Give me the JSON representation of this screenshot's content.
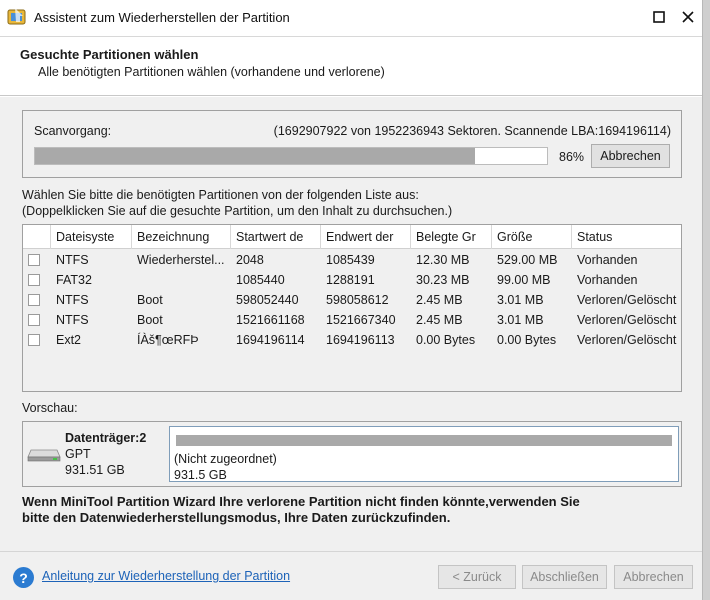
{
  "window": {
    "title": "Assistent zum Wiederherstellen der Partition"
  },
  "header": {
    "title": "Gesuchte Partitionen wählen",
    "subtitle": "Alle benötigten Partitionen wählen (vorhandene und verlorene)"
  },
  "scan": {
    "label": "Scanvorgang:",
    "info": "(1692907922 von 1952236943 Sektoren. Scannende LBA:1694196114)",
    "progress": 86,
    "progress_text": "86%",
    "cancel_label": "Abbrechen"
  },
  "instructions": {
    "line1": "Wählen Sie bitte die benötigten Partitionen von der folgenden Liste aus:",
    "line2": "(Doppelklicken Sie auf die gesuchte Partition, um den Inhalt zu durchsuchen.)"
  },
  "table": {
    "columns": [
      "Dateisyste",
      "Bezeichnung",
      "Startwert de",
      "Endwert der",
      "Belegte Gr",
      "Größe",
      "Status"
    ],
    "rows": [
      [
        "NTFS",
        "Wiederherstel...",
        "2048",
        "1085439",
        "12.30 MB",
        "529.00 MB",
        "Vorhanden"
      ],
      [
        "FAT32",
        "",
        "1085440",
        "1288191",
        "30.23 MB",
        "99.00 MB",
        "Vorhanden"
      ],
      [
        "NTFS",
        "Boot",
        "598052440",
        "598058612",
        "2.45 MB",
        "3.01 MB",
        "Verloren/Gelöscht"
      ],
      [
        "NTFS",
        "Boot",
        "1521661168",
        "1521667340",
        "2.45 MB",
        "3.01 MB",
        "Verloren/Gelöscht"
      ],
      [
        "Ext2",
        "ÍÀš¶œRFÞ",
        "1694196114",
        "1694196113",
        "0.00 Bytes",
        "0.00 Bytes",
        "Verloren/Gelöscht"
      ]
    ]
  },
  "preview": {
    "label": "Vorschau:",
    "disk_name": "Datenträger:2",
    "disk_type": "GPT",
    "disk_size": "931.51 GB",
    "partition_label": "(Nicht zugeordnet)",
    "partition_size": "931.5 GB"
  },
  "warning": "Wenn MiniTool Partition Wizard Ihre verlorene Partition nicht finden könnte,verwenden Sie bitte den Datenwiederherstellungsmodus, Ihre Daten zurückzufinden.",
  "footer": {
    "help_link": "Anleitung zur Wiederherstellung der Partition",
    "back_label": "< Zurück",
    "finish_label": "Abschließen",
    "cancel_label": "Abbrechen"
  },
  "icons": {
    "app": "partition-wizard-icon",
    "maximize": "maximize-icon",
    "close": "close-icon",
    "disk": "hard-disk-icon",
    "help": "help-icon"
  }
}
